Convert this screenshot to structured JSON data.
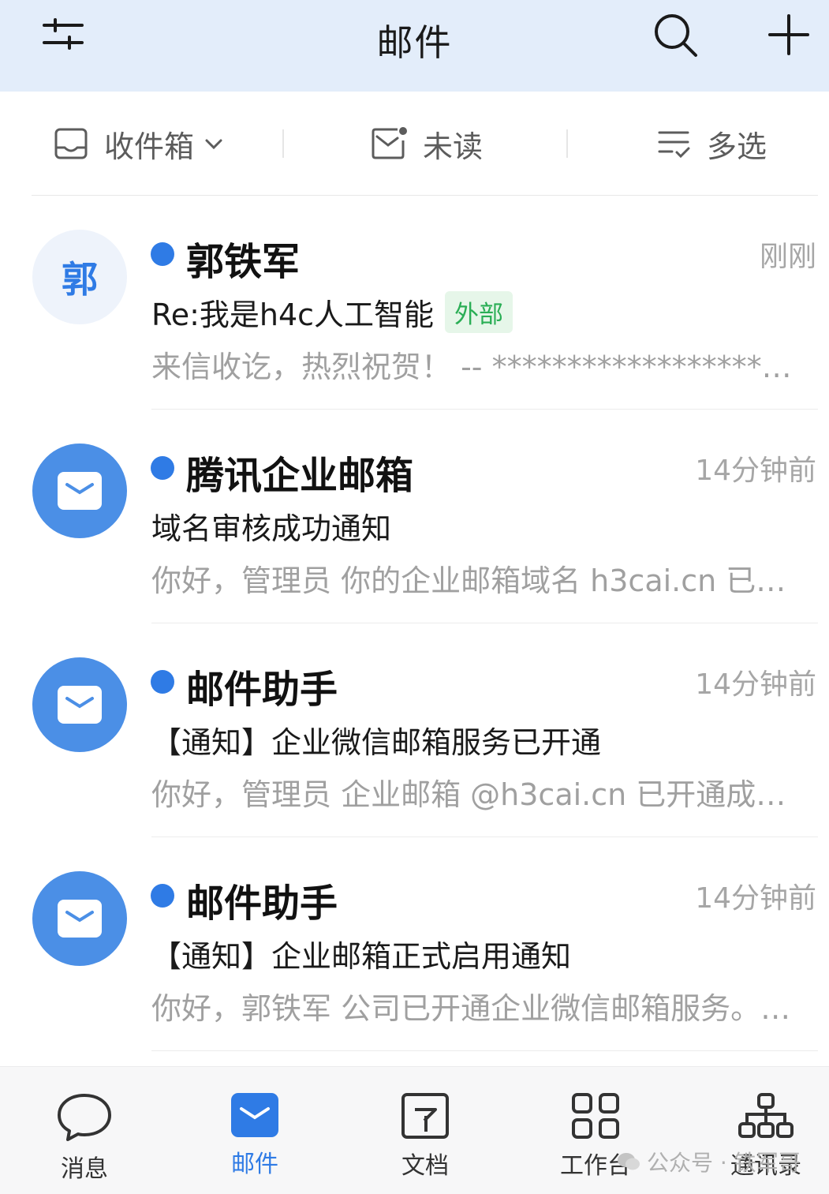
{
  "header": {
    "title": "邮件"
  },
  "filters": {
    "folder": "收件箱",
    "unread": "未读",
    "multiselect": "多选"
  },
  "mails": [
    {
      "sender": "郭铁军",
      "avatar_text": "郭",
      "time": "刚刚",
      "subject": "Re:我是h4c人工智能",
      "tag": "外部",
      "preview": "来信收讫，热烈祝贺！ -- *************************************"
    },
    {
      "sender": "腾讯企业邮箱",
      "time": "14分钟前",
      "subject": "域名审核成功通知",
      "preview": "你好，管理员 你的企业邮箱域名 h3cai.cn 已审核通过"
    },
    {
      "sender": "邮件助手",
      "time": "14分钟前",
      "subject": "【通知】企业微信邮箱服务已开通",
      "preview": "你好，管理员 企业邮箱 @h3cai.cn 已开通成功，可以使用"
    },
    {
      "sender": "邮件助手",
      "time": "14分钟前",
      "subject": "【通知】企业邮箱正式启用通知",
      "preview": "你好，郭铁军 公司已开通企业微信邮箱服务。欢迎使用"
    }
  ],
  "tabs": [
    {
      "label": "消息"
    },
    {
      "label": "邮件"
    },
    {
      "label": "文档"
    },
    {
      "label": "工作台"
    },
    {
      "label": "通讯录"
    }
  ],
  "watermark": "公众号 · 铁军哥",
  "colors": {
    "accent": "#2f7be5",
    "header_bg": "#e3edfa",
    "tag_text": "#2aae55",
    "tag_bg": "#e6f6e9"
  }
}
